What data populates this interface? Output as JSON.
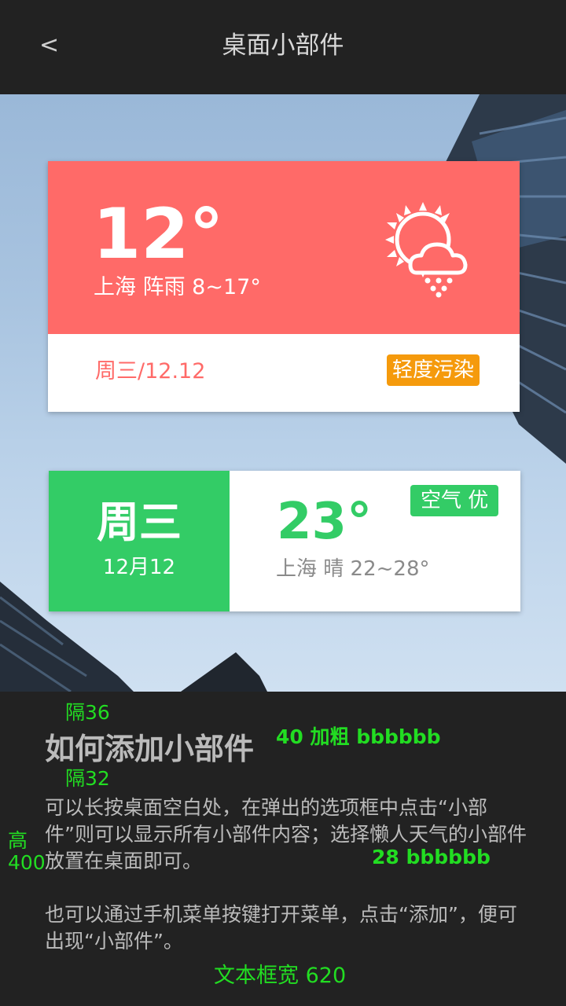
{
  "header": {
    "back_label": "<",
    "title": "桌面小部件"
  },
  "widget1": {
    "temperature": "12°",
    "location_summary": "上海 阵雨 8~17°",
    "weather_icon": "sun-cloud-rain-icon",
    "date": "周三/12.12",
    "air_badge": "轻度污染",
    "colors": {
      "primary": "#ff6a68",
      "badge": "#f59a0c"
    }
  },
  "widget2": {
    "day": "周三",
    "date": "12月12",
    "temperature": "23°",
    "location_summary": "上海 晴 22~28°",
    "air_badge": "空气 优",
    "colors": {
      "primary": "#33cc66"
    }
  },
  "help": {
    "title": "如何添加小部件",
    "paragraph1": "可以长按桌面空白处，在弹出的选项框中点击“小部件”则可以显示所有小部件内容；选择懒人天气的小部件放置在桌面即可。",
    "paragraph2": "也可以通过手机菜单按键打开菜单，点击“添加”，便可出现“小部件”。"
  },
  "annotations": {
    "gap_top": "隔36",
    "title_spec": "40 加粗  bbbbbb",
    "gap_title": "隔32",
    "height": "高\n400",
    "text_spec": "28  bbbbbb",
    "width": "文本框宽  620",
    "color": "#22dd22"
  }
}
